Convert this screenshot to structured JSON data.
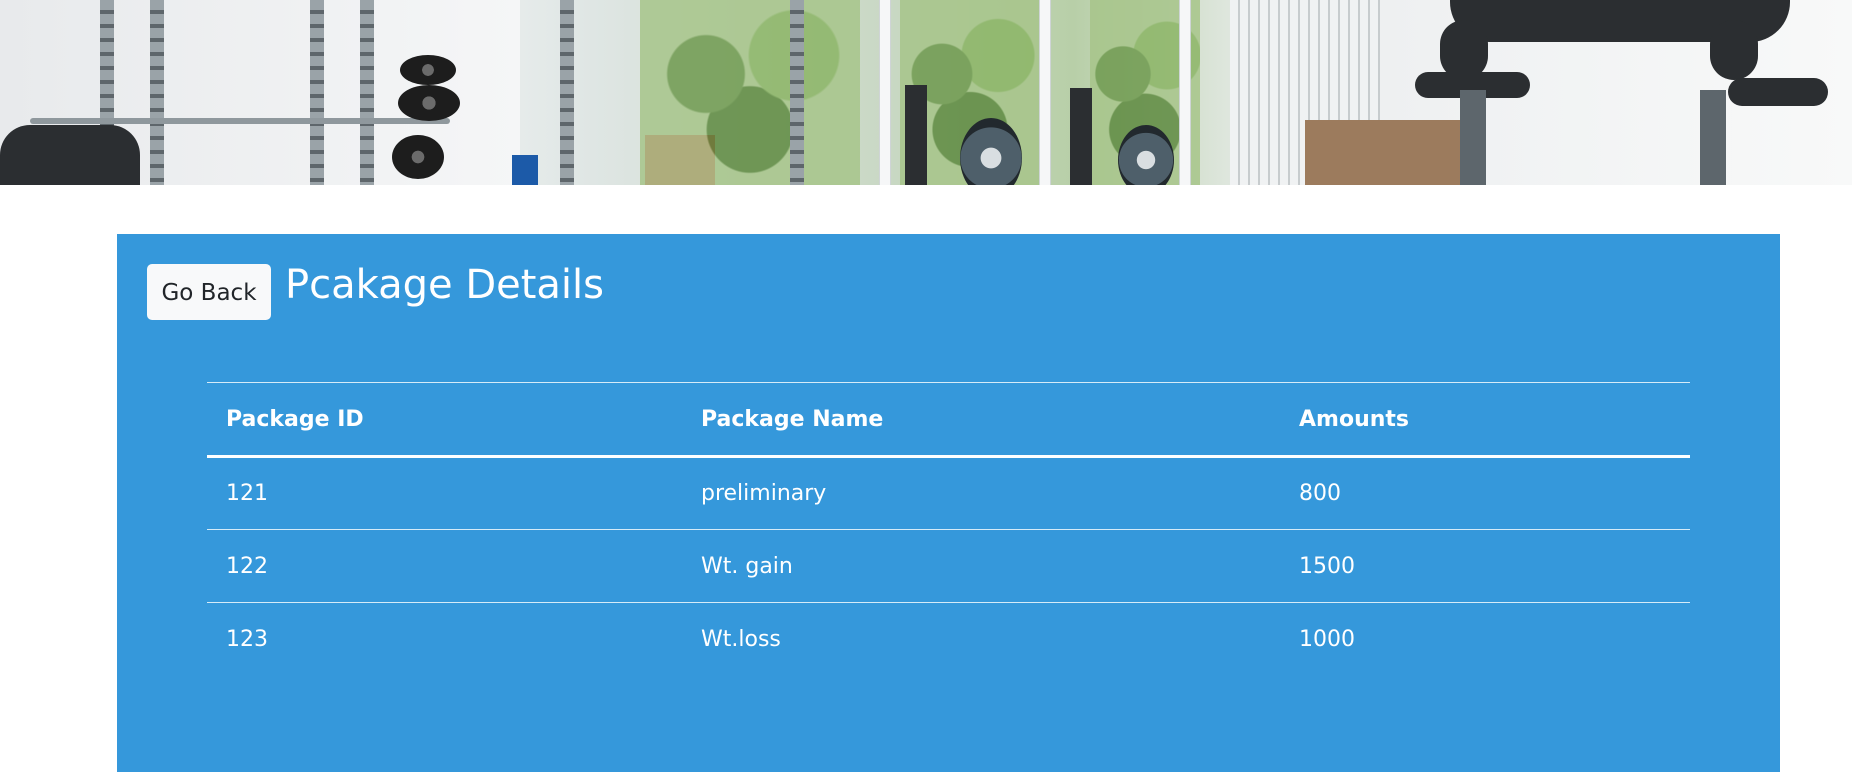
{
  "banner": {
    "image_description_icon": "gym-banner-image"
  },
  "header": {
    "go_back_label": "Go Back",
    "title": "Pcakage Details"
  },
  "table": {
    "columns": [
      "Package ID",
      "Package Name",
      "Amounts"
    ],
    "rows": [
      {
        "id": "121",
        "name": "preliminary",
        "amount": "800"
      },
      {
        "id": "122",
        "name": "Wt. gain",
        "amount": "1500"
      },
      {
        "id": "123",
        "name": "Wt.loss",
        "amount": "1000"
      }
    ]
  },
  "colors": {
    "panel_background": "#3598db",
    "button_background": "#f8f9fa",
    "text_on_panel": "#ffffff"
  }
}
